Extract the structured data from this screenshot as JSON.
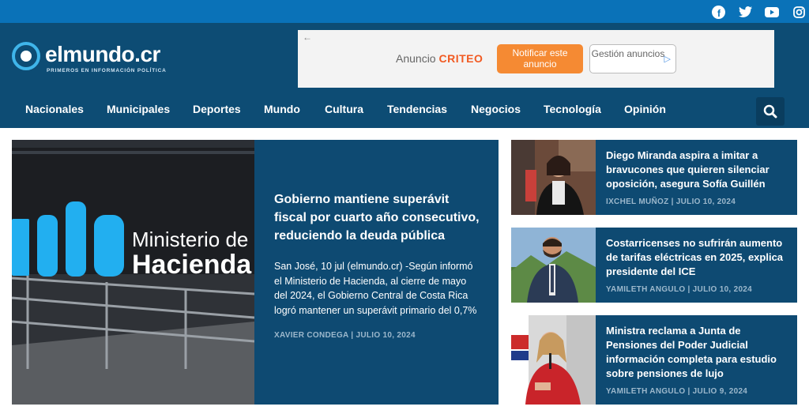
{
  "social": {
    "facebook": "f",
    "twitter": "t",
    "youtube": "▶",
    "instagram": "◎"
  },
  "logo": {
    "name": "elmundo.cr",
    "tagline": "PRIMEROS EN INFORMACIÓN POLÍTICA"
  },
  "ad": {
    "back": "←",
    "label": "Anuncio",
    "brand": "CRITEO",
    "notify": "Notificar este anuncio",
    "manage": "Gestión anuncios",
    "play": "▷"
  },
  "nav": {
    "items": [
      "Nacionales",
      "Municipales",
      "Deportes",
      "Mundo",
      "Cultura",
      "Tendencias",
      "Negocios",
      "Tecnología",
      "Opinión"
    ]
  },
  "main_article": {
    "image_text": {
      "line1": "Ministerio de",
      "line2": "Hacienda"
    },
    "title": "Gobierno mantiene superávit fiscal por cuarto año consecutivo, reduciendo la deuda pública",
    "body": "San José, 10 jul (elmundo.cr)  -Según informó el Ministerio de Hacienda, al cierre de mayo del 2024, el Gobierno Central de Costa Rica logró mantener un superávit primario del 0,7%",
    "meta": "XAVIER CONDEGA  |  JULIO 10, 2024"
  },
  "side_articles": [
    {
      "title": "Diego Miranda aspira a imitar a bravucones que quieren silenciar oposición, asegura Sofía Guillén",
      "meta": "IXCHEL MUÑOZ  |  JULIO 10, 2024"
    },
    {
      "title": "Costarricenses no sufrirán aumento de tarifas eléctricas en 2025, explica presidente del ICE",
      "meta": "YAMILETH ANGULO  |  JULIO 10, 2024"
    },
    {
      "title": "Ministra reclama a Junta de Pensiones del Poder Judicial información completa para estudio sobre pensiones de lujo",
      "meta": "YAMILETH ANGULO  |  JULIO 9, 2024"
    }
  ],
  "colors": {
    "topbar": "#0a72b8",
    "header": "#0d4c74",
    "card": "#0e4a72",
    "accent": "#3fb5ea"
  }
}
